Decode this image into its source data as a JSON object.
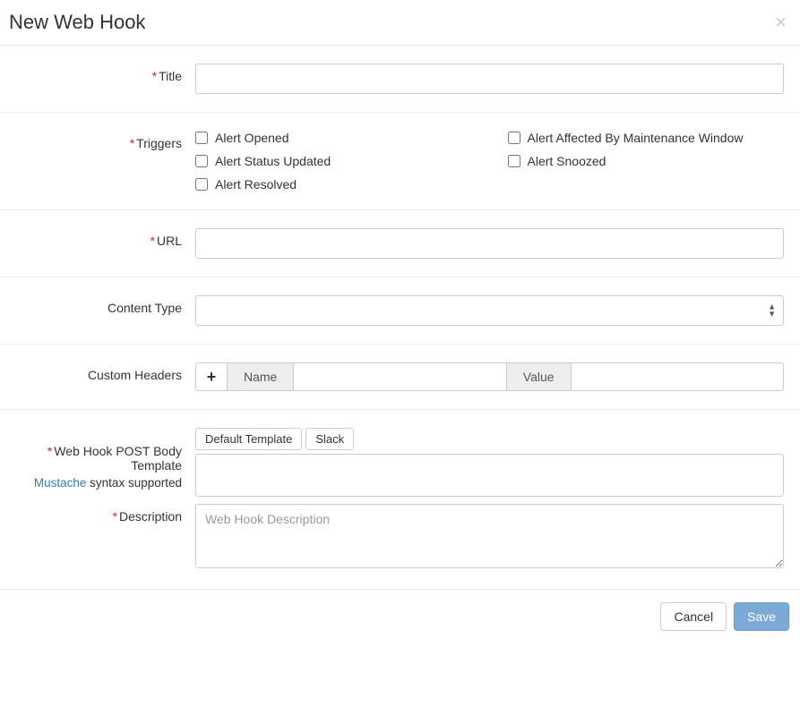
{
  "header": {
    "title": "New Web Hook"
  },
  "fields": {
    "title_label": "Title",
    "triggers_label": "Triggers",
    "url_label": "URL",
    "content_type_label": "Content Type",
    "custom_headers_label": "Custom Headers",
    "body_template_label": "Web Hook POST Body Template",
    "body_template_sub_link": "Mustache",
    "body_template_sub_text": " syntax supported",
    "description_label": "Description"
  },
  "triggers": {
    "col1": [
      "Alert Opened",
      "Alert Status Updated",
      "Alert Resolved"
    ],
    "col2": [
      "Alert Affected By Maintenance Window",
      "Alert Snoozed"
    ]
  },
  "headers": {
    "name_label": "Name",
    "value_label": "Value"
  },
  "template_buttons": {
    "default": "Default Template",
    "slack": "Slack"
  },
  "description": {
    "placeholder": "Web Hook Description"
  },
  "footer": {
    "cancel": "Cancel",
    "save": "Save"
  }
}
